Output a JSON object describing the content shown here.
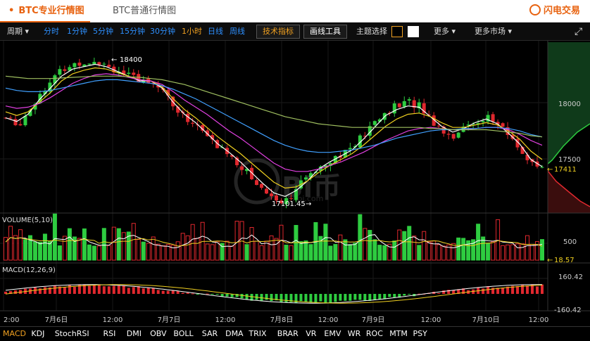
{
  "tabs": [
    {
      "label": "BTC专业行情图"
    },
    {
      "label": "BTC普通行情图"
    }
  ],
  "brand": {
    "name": "闪电交易"
  },
  "toolbar": {
    "period_label": "周期",
    "timeframes": [
      "分时",
      "1分钟",
      "5分钟",
      "15分钟",
      "30分钟",
      "1小时",
      "日线",
      "周线"
    ],
    "active_timeframe": "1小时",
    "tech_indicator": "技术指标",
    "drawing_tools": "画线工具",
    "theme_label": "主题选择",
    "more": "更多",
    "more_markets": "更多市场"
  },
  "price_axis": {
    "ticks": [
      "18000",
      "17500"
    ],
    "current": "17411"
  },
  "annotations": {
    "high": "18400",
    "low": "17101.45"
  },
  "volume": {
    "label": "VOLUME(5,10)",
    "ticks": [
      "500"
    ],
    "current": "18.57"
  },
  "macd": {
    "label": "MACD(12,26,9)",
    "ticks": [
      "160.42",
      "-160.42"
    ]
  },
  "time_axis": [
    "2:00",
    "7月6日",
    "12:00",
    "7月7日",
    "12:00",
    "7月8日",
    "12:00",
    "7月9日",
    "12:00",
    "7月10日",
    "12:00"
  ],
  "indicators": [
    "MACD",
    "KDJ",
    "StochRSI",
    "RSI",
    "DMI",
    "OBV",
    "BOLL",
    "SAR",
    "DMA",
    "TRIX",
    "BRAR",
    "VR",
    "EMV",
    "WR",
    "ROC",
    "MTM",
    "PSY"
  ],
  "active_indicator": "MACD",
  "watermark": "bitbi.com",
  "colors": {
    "up": "#2ecc40",
    "down": "#e0282e",
    "accent": "#e8620f",
    "link": "#2e90ff",
    "active": "#f0a020"
  },
  "chart_data": {
    "type": "candlestick",
    "x_labels": [
      "7月6日",
      "7月7日",
      "7月8日",
      "7月9日",
      "7月10日"
    ],
    "ylim": [
      17080,
      18450
    ],
    "close_path": [
      17850,
      17780,
      17900,
      18050,
      18150,
      18250,
      18300,
      18320,
      18340,
      18300,
      18250,
      18200,
      18150,
      18180,
      18100,
      17950,
      17850,
      17800,
      17700,
      17600,
      17550,
      17450,
      17350,
      17250,
      17180,
      17150,
      17250,
      17350,
      17450,
      17500,
      17550,
      17600,
      17700,
      17800,
      17900,
      17950,
      17980,
      17960,
      17850,
      17750,
      17700,
      17760,
      17820,
      17860,
      17800,
      17700,
      17600,
      17450,
      17411
    ],
    "ma_series": [
      {
        "color": "#ffffff",
        "values": [
          17850,
          17820,
          17880,
          18000,
          18100,
          18200,
          18260,
          18280,
          18300,
          18280,
          18240,
          18200,
          18160,
          18160,
          18100,
          17980,
          17880,
          17810,
          17720,
          17630,
          17560,
          17480,
          17390,
          17300,
          17220,
          17190,
          17240,
          17320,
          17420,
          17480,
          17530,
          17580,
          17670,
          17770,
          17870,
          17920,
          17950,
          17940,
          17860,
          17780,
          17730,
          17760,
          17810,
          17840,
          17800,
          17720,
          17630,
          17500,
          17440
        ]
      },
      {
        "color": "#f0d020",
        "values": [
          17900,
          17870,
          17900,
          17980,
          18060,
          18160,
          18220,
          18250,
          18270,
          18260,
          18230,
          18200,
          18170,
          18160,
          18110,
          18010,
          17920,
          17850,
          17770,
          17690,
          17620,
          17550,
          17470,
          17390,
          17310,
          17260,
          17270,
          17320,
          17390,
          17450,
          17500,
          17550,
          17620,
          17700,
          17780,
          17840,
          17880,
          17890,
          17860,
          17810,
          17770,
          17770,
          17790,
          17810,
          17790,
          17740,
          17670,
          17570,
          17500
        ]
      },
      {
        "color": "#e040e0",
        "values": [
          17950,
          17930,
          17940,
          17970,
          18020,
          18080,
          18140,
          18180,
          18210,
          18220,
          18210,
          18190,
          18170,
          18160,
          18130,
          18070,
          18000,
          17940,
          17880,
          17810,
          17740,
          17680,
          17610,
          17540,
          17470,
          17420,
          17400,
          17400,
          17420,
          17450,
          17480,
          17520,
          17560,
          17610,
          17660,
          17700,
          17740,
          17760,
          17770,
          17760,
          17750,
          17750,
          17760,
          17770,
          17770,
          17750,
          17710,
          17660,
          17620
        ]
      },
      {
        "color": "#40a0ff",
        "values": [
          18100,
          18080,
          18070,
          18070,
          18080,
          18100,
          18120,
          18140,
          18160,
          18170,
          18170,
          18160,
          18150,
          18140,
          18120,
          18090,
          18050,
          18010,
          17960,
          17910,
          17860,
          17810,
          17760,
          17710,
          17660,
          17620,
          17590,
          17570,
          17560,
          17560,
          17570,
          17580,
          17600,
          17620,
          17650,
          17680,
          17700,
          17720,
          17740,
          17750,
          17750,
          17760,
          17760,
          17770,
          17770,
          17760,
          17740,
          17710,
          17690
        ]
      },
      {
        "color": "#a0c060",
        "values": [
          18200,
          18190,
          18180,
          18180,
          18180,
          18185,
          18190,
          18195,
          18200,
          18200,
          18200,
          18195,
          18190,
          18180,
          18170,
          18150,
          18130,
          18100,
          18070,
          18040,
          18010,
          17980,
          17950,
          17920,
          17890,
          17860,
          17840,
          17820,
          17800,
          17790,
          17780,
          17770,
          17770,
          17770,
          17770,
          17770,
          17770,
          17770,
          17760,
          17760,
          17750,
          17750,
          17750,
          17750,
          17740,
          17730,
          17720,
          17700,
          17690
        ]
      }
    ]
  }
}
